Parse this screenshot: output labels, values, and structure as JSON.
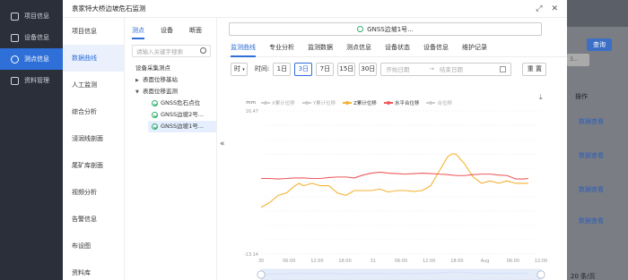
{
  "background": {
    "sidebar_items": [
      {
        "label": "项目信息",
        "active": false
      },
      {
        "label": "设备信息",
        "active": false
      },
      {
        "label": "测点信息",
        "active": true
      },
      {
        "label": "资料管理",
        "active": false
      }
    ],
    "query_label": "查询",
    "select_value": "3...",
    "op_header": "操作",
    "link_label": "数据查看",
    "pager_label": "20 条/页"
  },
  "modal": {
    "title": "袁家特大桥边坡危石监测",
    "left_menu": [
      "项目信息",
      "数据曲线",
      "人工监测",
      "综合分析",
      "浸润线剖面",
      "尾矿库剖面",
      "视频分析",
      "告警信息",
      "布设图",
      "资料库"
    ],
    "left_active_index": 1,
    "tree": {
      "tabs": [
        "测点",
        "设备",
        "断面"
      ],
      "active_tab": 0,
      "search_placeholder": "请输入关键字搜索",
      "root": "设备采集测点",
      "group1": "表面位移基站",
      "group2": "表面位移监测",
      "leaves": [
        "GNSS危石点位",
        "GNSS边坡2号...",
        "GNSS边坡1号..."
      ],
      "selected_leaf": 2
    },
    "station": "GNSS边坡1号...",
    "tabs": [
      "监测曲线",
      "专业分析",
      "监测数据",
      "测点信息",
      "设备状态",
      "设备信息",
      "维护记录"
    ],
    "active_tab": 0,
    "filter": {
      "period_select": "时",
      "time_label": "时间:",
      "ranges": [
        "1日",
        "3日",
        "7日",
        "15日",
        "30日"
      ],
      "active_range": 1,
      "start_placeholder": "开始日期",
      "arrow": "→",
      "end_placeholder": "结束日期",
      "reset_label": "重 置"
    }
  },
  "chart_data": {
    "type": "line",
    "y_unit": "mm",
    "ylim": [
      -13.14,
      16.47
    ],
    "y_ticks": [
      "16.47",
      "",
      "",
      "",
      "",
      "",
      "",
      "",
      "",
      "",
      "-13.14"
    ],
    "x_ticks": [
      "30",
      "06:00",
      "12:00",
      "18:00",
      "31",
      "06:00",
      "12:00",
      "18:00",
      "Aug",
      "06:00",
      "12:00"
    ],
    "x_range": [
      0,
      66
    ],
    "legend": [
      {
        "name": "X累计位移",
        "color": "#cccccc",
        "active": false
      },
      {
        "name": "Y累计位移",
        "color": "#cccccc",
        "active": false
      },
      {
        "name": "Z累计位移",
        "color": "#f5b335",
        "active": true
      },
      {
        "name": "水平合位移",
        "color": "#ee5a5a",
        "active": true
      },
      {
        "name": "合位移",
        "color": "#cccccc",
        "active": false
      }
    ],
    "series": [
      {
        "name": "Z累计位移",
        "color": "#f5b335",
        "x": [
          0,
          2,
          4,
          6,
          8,
          9,
          10,
          12,
          14,
          16,
          18,
          20,
          22,
          24,
          26,
          28,
          30,
          32,
          34,
          36,
          38,
          40,
          42,
          44,
          45,
          46,
          48,
          50,
          52,
          54,
          56,
          58,
          60,
          62,
          63
        ],
        "values": [
          -3.5,
          -2.5,
          -1,
          -0.5,
          1,
          1.5,
          1,
          1.5,
          1,
          1,
          -0.5,
          -1,
          0,
          0,
          0,
          0.3,
          -0.3,
          0,
          0,
          -0.2,
          0,
          1,
          4,
          7,
          7.6,
          7.5,
          5.5,
          2.8,
          1.5,
          2,
          1.5,
          2,
          1.5,
          1.5,
          1.5
        ]
      },
      {
        "name": "水平合位移",
        "color": "#ee5a5a",
        "x": [
          0,
          2,
          4,
          6,
          8,
          10,
          12,
          14,
          16,
          18,
          20,
          22,
          24,
          26,
          28,
          30,
          32,
          34,
          36,
          38,
          40,
          42,
          44,
          46,
          48,
          50,
          52,
          54,
          56,
          58,
          60,
          62,
          63
        ],
        "values": [
          2.5,
          2.5,
          2.4,
          2.5,
          2.6,
          2.6,
          2.5,
          2.5,
          2.7,
          2.8,
          2.8,
          2.6,
          3.2,
          3.6,
          3.8,
          3.6,
          3.5,
          3.4,
          3.5,
          3.6,
          3.5,
          3.4,
          3.3,
          3.1,
          3.1,
          3.3,
          3.4,
          3.4,
          3.2,
          3.1,
          2.4,
          2.4,
          2.5
        ]
      }
    ],
    "zoom_range": [
      0,
      100
    ]
  }
}
